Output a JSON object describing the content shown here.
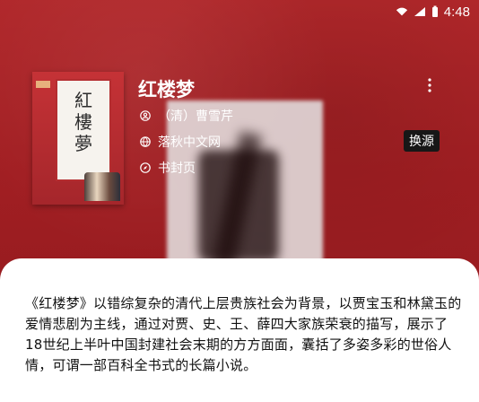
{
  "status_bar": {
    "time": "4:48",
    "icons": [
      "wifi-icon",
      "signal-icon",
      "battery-icon"
    ]
  },
  "book": {
    "title": "红楼梦",
    "author": "（清）曹雪芹",
    "source": "落秋中文网",
    "cover_page": "书封页",
    "cover_title": "紅樓夢"
  },
  "actions": {
    "swap_source": "换源",
    "more_icon": "more-vertical-icon"
  },
  "description": "《红楼梦》以错综复杂的清代上层贵族社会为背景，以贾宝玉和林黛玉的爱情悲剧为主线，通过对贾、史、王、薛四大家族荣衰的描写，展示了18世纪上半叶中国封建社会末期的方方面面，囊括了多姿多彩的世俗人情，可谓一部百科全书式的长篇小说。",
  "colors": {
    "background_red": "#a71f22",
    "sheet_white": "#ffffff",
    "badge_black": "#171717"
  }
}
